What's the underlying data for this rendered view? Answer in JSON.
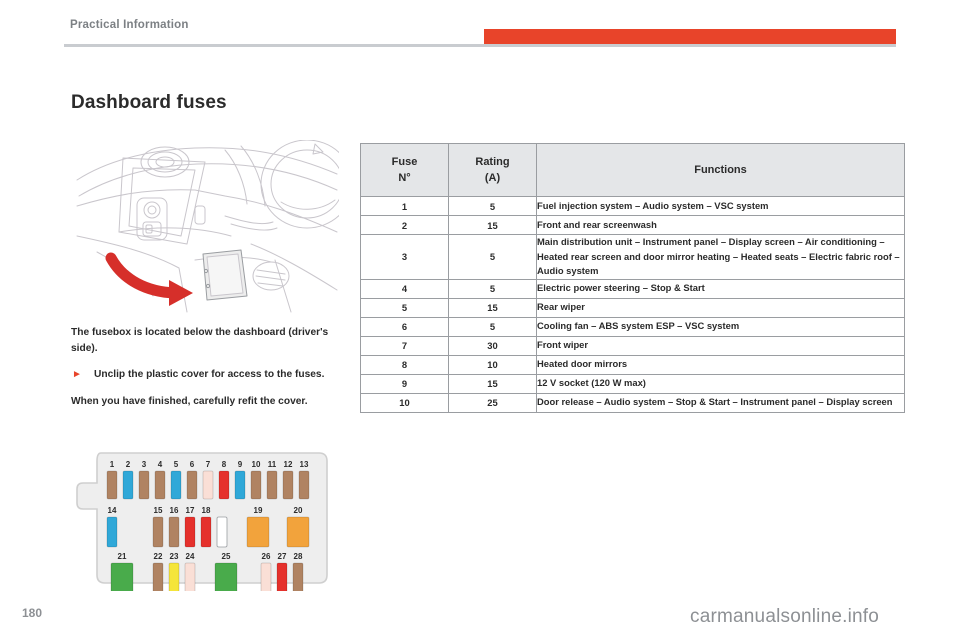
{
  "header": {
    "chapter": "Practical Information"
  },
  "page": {
    "title": "Dashboard fuses",
    "number": "180",
    "watermark": "carmanualsonline.info"
  },
  "body": {
    "intro": "The fusebox is located below the dashboard (driver's side).",
    "bullet_marker": "►",
    "bullet": "Unclip the plastic cover for access to the fuses.",
    "outro": "When you have finished, carefully refit the cover."
  },
  "figures": {
    "dashboard_caption": "dashboard-fusebox-location-illustration",
    "arrow_color": "#d62f2a",
    "fusebox_caption": "fusebox-layout-diagram",
    "fuse_colors": {
      "brown": "#b08362",
      "blue": "#30a8d8",
      "pink": "#fadfd6",
      "red": "#e5312c",
      "orange": "#f2a33c",
      "green": "#49ab4b",
      "yellow": "#f5e53a",
      "empty": "#ffffff"
    },
    "fuse_slots": [
      {
        "n": "1",
        "color": "brown",
        "row": 1,
        "wide": false
      },
      {
        "n": "2",
        "color": "blue",
        "row": 1,
        "wide": false
      },
      {
        "n": "3",
        "color": "brown",
        "row": 1,
        "wide": false
      },
      {
        "n": "4",
        "color": "brown",
        "row": 1,
        "wide": false
      },
      {
        "n": "5",
        "color": "blue",
        "row": 1,
        "wide": false
      },
      {
        "n": "6",
        "color": "brown",
        "row": 1,
        "wide": false
      },
      {
        "n": "7",
        "color": "pink",
        "row": 1,
        "wide": false
      },
      {
        "n": "8",
        "color": "red",
        "row": 1,
        "wide": false
      },
      {
        "n": "9",
        "color": "blue",
        "row": 1,
        "wide": false
      },
      {
        "n": "10",
        "color": "brown",
        "row": 1,
        "wide": false
      },
      {
        "n": "11",
        "color": "brown",
        "row": 1,
        "wide": false
      },
      {
        "n": "12",
        "color": "brown",
        "row": 1,
        "wide": false
      },
      {
        "n": "13",
        "color": "brown",
        "row": 1,
        "wide": false
      },
      {
        "n": "14",
        "color": "blue",
        "row": 2,
        "wide": false
      },
      {
        "n": "15",
        "color": "brown",
        "row": 2,
        "wide": false
      },
      {
        "n": "16",
        "color": "brown",
        "row": 2,
        "wide": false
      },
      {
        "n": "17",
        "color": "red",
        "row": 2,
        "wide": false
      },
      {
        "n": "18",
        "color": "red",
        "row": 2,
        "wide": false
      },
      {
        "n": "",
        "color": "empty",
        "row": 2,
        "wide": false
      },
      {
        "n": "19",
        "color": "orange",
        "row": 2,
        "wide": true
      },
      {
        "n": "20",
        "color": "orange",
        "row": 2,
        "wide": true
      },
      {
        "n": "21",
        "color": "green",
        "row": 3,
        "wide": true
      },
      {
        "n": "22",
        "color": "brown",
        "row": 3,
        "wide": false
      },
      {
        "n": "23",
        "color": "yellow",
        "row": 3,
        "wide": false
      },
      {
        "n": "24",
        "color": "pink",
        "row": 3,
        "wide": false
      },
      {
        "n": "25",
        "color": "green",
        "row": 3,
        "wide": true
      },
      {
        "n": "26",
        "color": "pink",
        "row": 3,
        "wide": false
      },
      {
        "n": "27",
        "color": "red",
        "row": 3,
        "wide": false
      },
      {
        "n": "28",
        "color": "brown",
        "row": 3,
        "wide": false
      }
    ]
  },
  "table": {
    "headers": {
      "fuse_line1": "Fuse",
      "fuse_line2": "N°",
      "rating_line1": "Rating",
      "rating_line2": "(A)",
      "functions": "Functions"
    },
    "rows": [
      {
        "no": "1",
        "rating": "5",
        "functions": "Fuel injection system – Audio system – VSC system"
      },
      {
        "no": "2",
        "rating": "15",
        "functions": "Front and rear screenwash"
      },
      {
        "no": "3",
        "rating": "5",
        "functions": "Main distribution unit – Instrument panel – Display screen – Air conditioning – Heated rear screen and door mirror heating – Heated seats – Electric fabric roof – Audio system"
      },
      {
        "no": "4",
        "rating": "5",
        "functions": "Electric power steering – Stop & Start"
      },
      {
        "no": "5",
        "rating": "15",
        "functions": "Rear wiper"
      },
      {
        "no": "6",
        "rating": "5",
        "functions": "Cooling fan – ABS system ESP – VSC system"
      },
      {
        "no": "7",
        "rating": "30",
        "functions": "Front wiper"
      },
      {
        "no": "8",
        "rating": "10",
        "functions": "Heated door mirrors"
      },
      {
        "no": "9",
        "rating": "15",
        "functions": "12 V socket (120 W max)"
      },
      {
        "no": "10",
        "rating": "25",
        "functions": "Door release – Audio system – Stop & Start – Instrument panel – Display screen"
      }
    ]
  }
}
